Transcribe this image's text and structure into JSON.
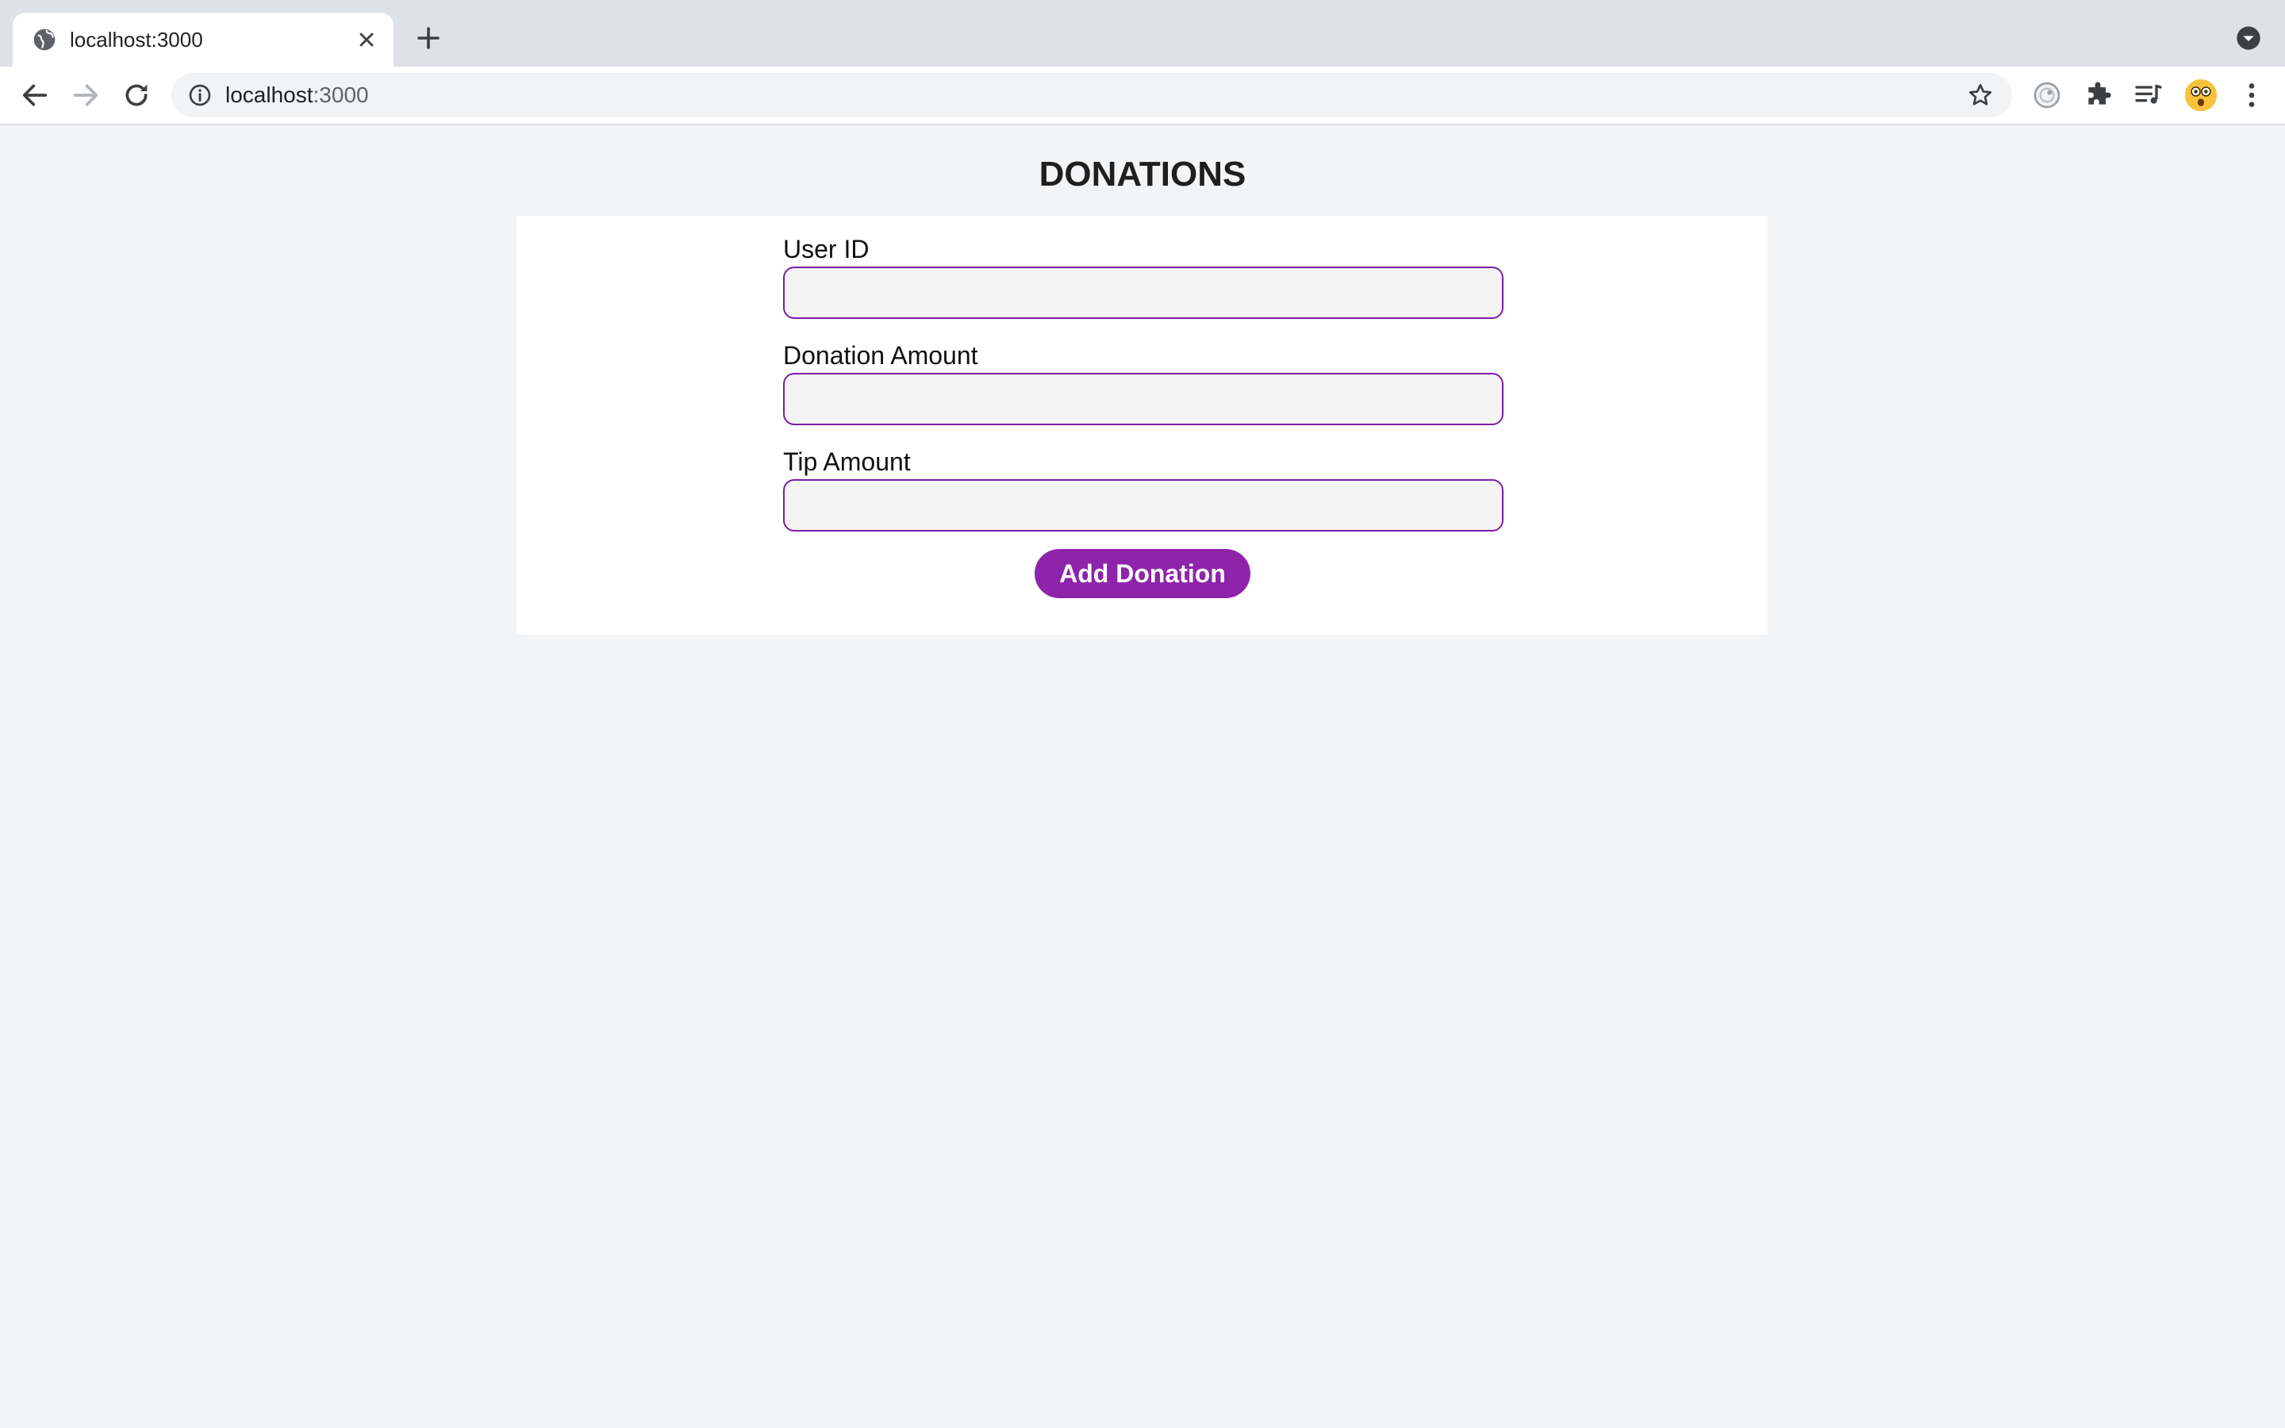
{
  "browser": {
    "tab": {
      "title": "localhost:3000"
    },
    "address_bar": {
      "host": "localhost",
      "port": ":3000"
    }
  },
  "page": {
    "heading": "DONATIONS",
    "form": {
      "fields": [
        {
          "label": "User ID",
          "value": "",
          "placeholder": ""
        },
        {
          "label": "Donation Amount",
          "value": "",
          "placeholder": ""
        },
        {
          "label": "Tip Amount",
          "value": "",
          "placeholder": ""
        }
      ],
      "submit_label": "Add Donation"
    }
  },
  "icons": [
    "globe-icon",
    "close-icon",
    "plus-icon",
    "chevron-down-icon",
    "back-arrow-icon",
    "forward-arrow-icon",
    "reload-icon",
    "info-icon",
    "star-icon",
    "privacy-badge-icon",
    "puzzle-icon",
    "media-queue-icon",
    "profile-avatar-icon",
    "kebab-menu-icon"
  ],
  "colors": {
    "accent_purple": "#8e24aa",
    "input_border": "#7b1fa2",
    "page_background": "#f3f4f6",
    "tabstrip_background": "#dee1e6"
  }
}
